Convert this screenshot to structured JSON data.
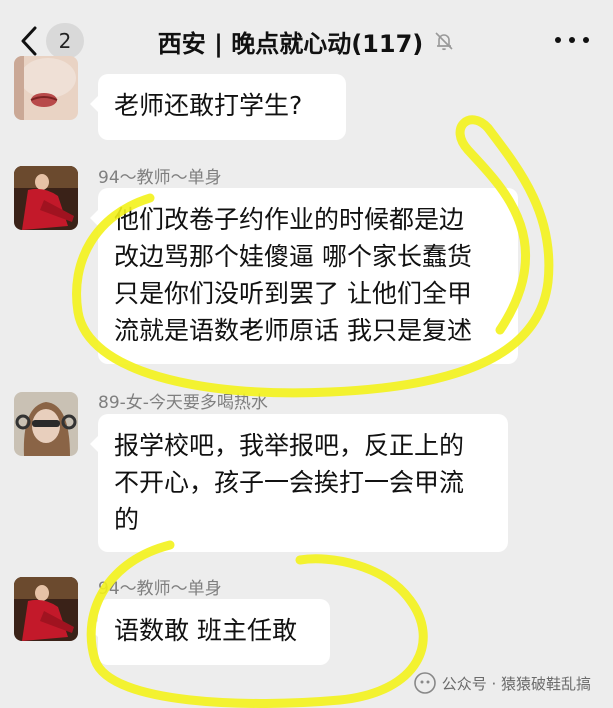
{
  "header": {
    "back_count": "2",
    "title": "西安 | 晚点就心动(117)",
    "mute_icon": "bell-muted-icon",
    "more_icon": "more-dots-icon"
  },
  "messages": [
    {
      "sender": "",
      "lines": [
        "老师还敢打学生?"
      ]
    },
    {
      "sender": "94～教师～单身",
      "lines": [
        "他们改卷子约作业的时候都是边",
        "改边骂那个娃傻逼 哪个家长蠢货",
        "只是你们没听到罢了 让他们全甲",
        "流就是语数老师原话 我只是复述"
      ]
    },
    {
      "sender": "89-女-今天要多喝热水",
      "lines": [
        "报学校吧，我举报吧，反正上的",
        "不开心，孩子一会挨打一会甲流",
        "的"
      ]
    },
    {
      "sender": "94～教师～单身",
      "lines": [
        "语数敢 班主任敢"
      ]
    }
  ],
  "watermark": {
    "text": "公众号 · 猿猿破鞋乱搞",
    "icon": "wechat-official-account-icon"
  },
  "colors": {
    "background": "#ededed",
    "bubble": "#ffffff",
    "highlight": "#f2f21a",
    "sender_text": "#7f7f7f"
  }
}
